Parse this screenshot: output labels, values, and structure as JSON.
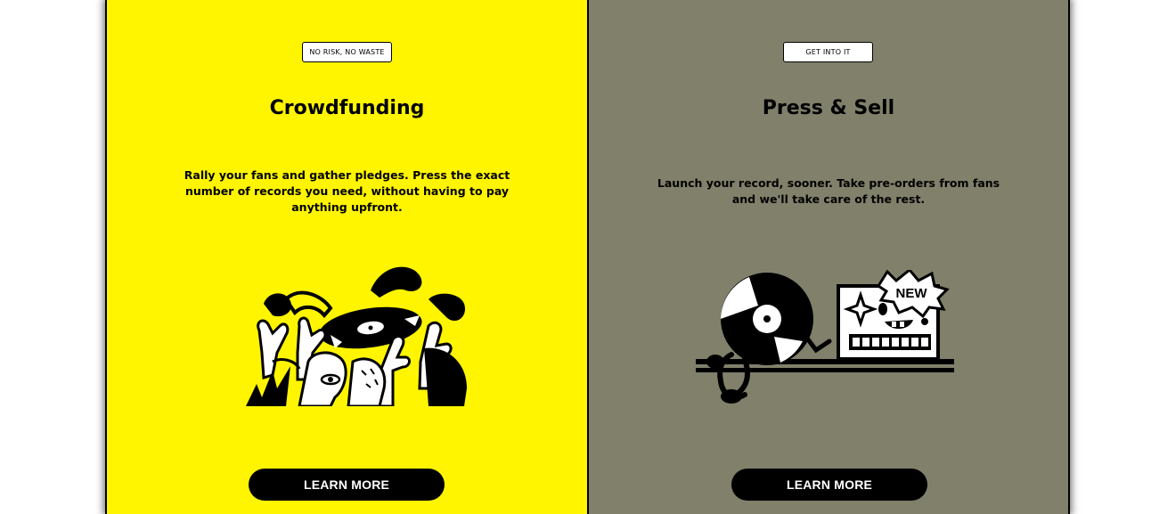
{
  "colors": {
    "crowdfunding_bg": "#fff500",
    "press_sell_bg": "#80806b",
    "button_bg": "#000000",
    "button_text": "#ffffff"
  },
  "cards": [
    {
      "badge": "NO RISK, NO WASTE",
      "title": "Crowdfunding",
      "description": "Rally your fans and gather pledges. Press the exact number of records you need, without having to pay anything upfront.",
      "illustration": "crowd-holding-vinyl-illustration",
      "button_label": "LEARN MORE"
    },
    {
      "badge": "GET INTO IT",
      "title": "Press & Sell",
      "description": "Launch your record, sooner. Take pre-orders from fans and we'll take care of the rest.",
      "illustration": "vinyl-character-with-new-box-illustration",
      "button_label": "LEARN MORE",
      "illustration_text": "NEW"
    }
  ]
}
